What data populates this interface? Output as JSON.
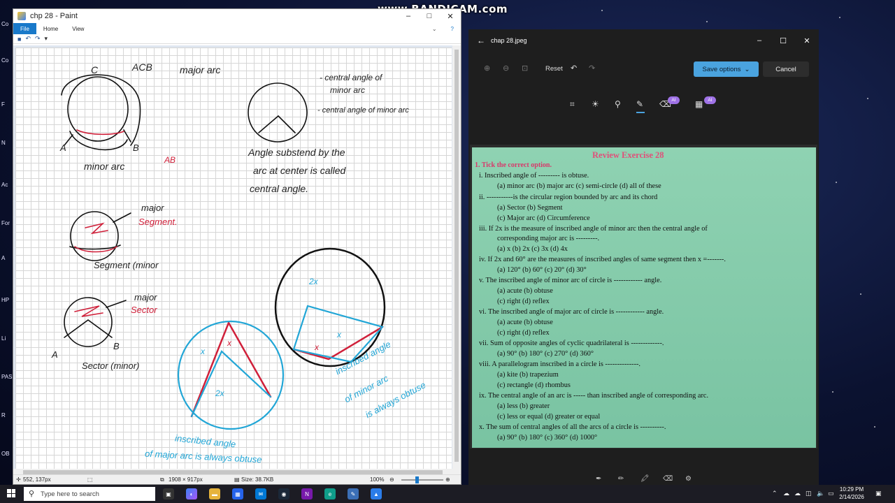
{
  "watermark": "www.BANDICAM.com",
  "paint": {
    "title": "chp 28 - Paint",
    "tabs": [
      "File",
      "Home",
      "View"
    ],
    "status": {
      "cursor": "552, 137px",
      "size": "1908 × 917px",
      "file_size": "Size: 38.7KB",
      "zoom": "100%"
    },
    "drawing": {
      "acb_label": "ACB",
      "major_arc": "major arc",
      "c_label": "C",
      "a_label": "A",
      "b_label": "B",
      "minor_arc": "minor arc",
      "ab_label": "AB",
      "central_minor": "- central angle of",
      "central_minor2": "minor arc",
      "central_minor3": "- central angle of minor arc",
      "def1": "Angle substend by the",
      "def2": "arc at center is called",
      "def3": "central angle.",
      "major_seg": "major",
      "segment": "Segment.",
      "segment_minor": "Segment (minor",
      "major_sector": "major",
      "sector": "Sector",
      "sector_minor": "Sector (minor)",
      "a2": "A",
      "b2": "B",
      "x1": "x",
      "x2": "x",
      "two_x1": "2x",
      "two_x2": "2x",
      "x3": "x",
      "x4": "x",
      "obtuse1": "inscribed angle",
      "obtuse2": "of minor arc",
      "obtuse3": "is always obtuse",
      "acute1": "inscribed angle",
      "acute2": "of major arc is always obtuse"
    }
  },
  "photos": {
    "title": "chap 28.jpeg",
    "reset": "Reset",
    "save_options": "Save options",
    "cancel": "Cancel",
    "ai_badge": "AI",
    "page": {
      "heading": "Review Exercise 28",
      "instruction": "1. Tick the correct option.",
      "q": [
        "i.   Inscribed angle of --------- is obtuse.",
        "(a)  minor arc      (b)    major arc      (c)    semi-circle     (d)    all of these",
        "ii.   -----------is the circular region bounded by arc and its chord",
        "(a)  Sector                       (b)    Segment",
        "(c)  Major arc                   (d)    Circumference",
        "iii.  If 2x is the measure of inscribed angle of minor arc then the central angle of",
        "corresponding major arc is ---------.",
        "(a)  x                  (b)    2x                (c)    3x                (d)    4x",
        "iv.  If 2x and 60° are the measures of inscribed angles of same segment then x =-------.",
        "(a)  120°            (b)    60°               (c)    20°              (d)    30°",
        "v.   The inscribed angle of minor arc of circle is ------------ angle.",
        "(a)  acute                       (b)    obtuse",
        "(c)  right                        (d)    reflex",
        "vi.  The inscribed angle of major arc of circle is ------------ angle.",
        "(a)  acute                       (b)    obtuse",
        "(c)  right                        (d)    reflex",
        "vii.  Sum of opposite angles of cyclic quadrilateral is -------------.",
        "(a)  90°             (b)    180°             (c)    270°            (d)    360°",
        "viii. A parallelogram inscribed in a circle is --------------.",
        "(a)  kite                          (b)    trapezium",
        "(c)  rectangle                  (d)    rhombus",
        "ix.  The central angle of an arc is ----- than inscribed angle of corresponding arc.",
        "(a)  less                          (b)    greater",
        "(c)  less or equal              (d)    greater or equal",
        "x.   The sum of central angles of all the arcs of a circle is ----------.",
        "(a)  90°             (b)    180°             (c)    360°             (d)    1000°"
      ]
    }
  },
  "taskbar": {
    "search_placeholder": "Type here to search",
    "time": "10:29 PM",
    "date": "2/14/2026"
  },
  "colors": {
    "paint_accent": "#1979ca",
    "photos_accent": "#4aa3df",
    "ink_red": "#d0203a",
    "ink_blue": "#22a6d6",
    "page_green": "#7fc9a8"
  }
}
